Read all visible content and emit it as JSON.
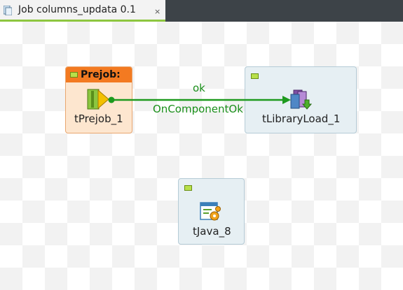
{
  "tab": {
    "title": "Job columns_updata 0.1",
    "close": "×"
  },
  "subjobs": {
    "prejob": {
      "title": "Prejob:",
      "component_label": "tPrejob_1"
    },
    "library": {
      "component_label": "tLibraryLoad_1"
    },
    "java": {
      "component_label": "tJava_8"
    }
  },
  "connection": {
    "trigger_label": "ok",
    "type_label": "OnComponentOk",
    "color": "#1e9a1e"
  },
  "colors": {
    "accent": "#8dc63f",
    "prejob_header": "#f37a21",
    "tab_bar": "#3d4348"
  }
}
